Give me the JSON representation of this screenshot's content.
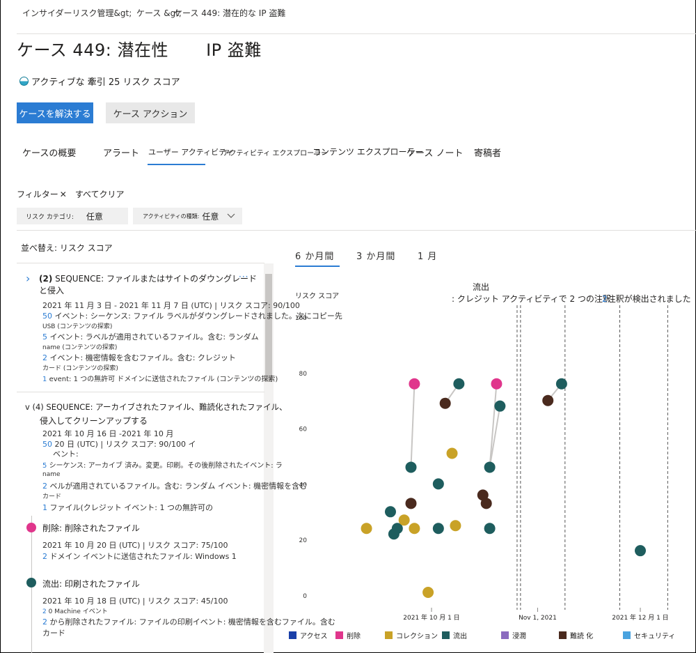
{
  "breadcrumb": {
    "item1": "インサイダーリスク管理&gt;",
    "item2": "ケース &gt;",
    "item3": "ケース 449: 潜在的な IP 盗難"
  },
  "header": {
    "title_part1": "ケース 449: 潜在性",
    "title_part2": "IP 盗難",
    "status_text": "アクティブな 牽引 25 リスク スコア"
  },
  "actions": {
    "resolve_label": "ケースを解決する",
    "case_actions_label": "ケース アクション"
  },
  "tabs": [
    {
      "label": "ケースの概要"
    },
    {
      "label": "アラート"
    },
    {
      "label": "ユーザー アクティビティ"
    },
    {
      "label": "アクティビティ エクスプローラー"
    },
    {
      "label": "コンテンツ エクスプローラー"
    },
    {
      "label": "ケース ノート"
    },
    {
      "label": "寄稿者"
    }
  ],
  "filters": {
    "filter_label": "フィルター",
    "clear_all": "すべてクリア",
    "risk_category_label": "リスク カテゴリ:",
    "risk_category_value": "任意",
    "activity_type_label": "アクティビティの種類:",
    "activity_type_value": "任意"
  },
  "list": {
    "sort_label": "並べ替え: リスク スコア",
    "seq1": {
      "title_count": "(2)",
      "title_rest": "SEQUENCE: ファイルまたはサイトのダウングレード",
      "title_line2": "と侵入",
      "date_line": "2021 年 11 月 3 日 - 2021 年 11 月 7 日 (UTC) | リスク スコア: 90/100",
      "l1_num": "50",
      "l1_text": "イベント: シーケンス: ファイル ラベルがダウングレードされました。次にコピー先",
      "l1b": "USB (コンテンツの探索)",
      "l2_num": "5",
      "l2_text": "イベント: ラベルが適用されているファイル。含む: ランダム",
      "l2b": "name (コンテンツの探索)",
      "l3_num": "2",
      "l3_text": "イベント: 機密情報を含むファイル。含む: クレジット",
      "l3b": "カード (コンテンツの探索)",
      "l4_num": "1",
      "l4_text": "event: 1 つの無許可 ドメインに送信されたファイル (コンテンツの探索)"
    },
    "seq2": {
      "title": "v (4) SEQUENCE: アーカイブされたファイル、難読化されたファイル、",
      "title_line2": "侵入してクリーンアップする",
      "date_line": "2021 年 10 月 16 日 -2021 年 10 月",
      "l1_num": "50",
      "l1_text": "20 日 (UTC) | リスク スコア: 90/100 イ",
      "l1b": "ベント:",
      "l2_num": "5",
      "l2_text": "シーケンス: アーカイブ 済み。変更。印刷。その後削除されたイベント: ラ",
      "l2b": "name",
      "l3_num": "2",
      "l3_text": "ベルが適用されているファイル。含む: ランダム イベント: 機密情報を含む",
      "l3b": "カード",
      "l4_num": "1",
      "l4_text": "ファイル(クレジット イベント: 1 つの無許可の"
    },
    "ev1": {
      "title": "削除: 削除されたファイル",
      "date_line": "2021 年 10 月 20 日 (UTC) | リスク スコア: 75/100",
      "l1_num": "2",
      "l1_text": "ドメイン イベントに送信されたファイル: Windows 1"
    },
    "ev2": {
      "title": "流出: 印刷されたファイル",
      "date_line": "2021 年 10 月 18 日 (UTC) | リスク スコア: 45/100",
      "l1_num": "2",
      "l1_text": "0 Machine イベント",
      "l2_num": "2",
      "l2_text": "から削除されたファイル: ファイルの印刷イベント: 機密情報を含むファイル。含む",
      "l2b": "カード"
    }
  },
  "chart_tabs": [
    {
      "label": "6 か月間"
    },
    {
      "label": "3 か月間"
    },
    {
      "label": "1 月"
    }
  ],
  "chart_annotations": {
    "a1_line1": "流出",
    "a1_line2": ": クレジット アクティビティで 2 つの注釈",
    "a2_num": "2",
    "a2_text": "注釈が検出されました"
  },
  "legend": [
    {
      "label": "アクセス",
      "color": "#1a3fa8"
    },
    {
      "label": "削除",
      "color": "#e0368c"
    },
    {
      "label": "コレクション",
      "color": "#c9a227"
    },
    {
      "label": "流出",
      "color": "#1e5d5e"
    },
    {
      "label": "浸潤",
      "color": "#8b6bbf"
    },
    {
      "label": "難読 化",
      "color": "#4a2a1e"
    },
    {
      "label": "セキュリティ",
      "color": "#4aa3df"
    }
  ],
  "chart_data": {
    "type": "scatter",
    "title": "",
    "ylabel": "リスク スコア",
    "ylim": [
      0,
      100
    ],
    "yticks": [
      "0",
      "20",
      "40",
      "60",
      "80",
      "100"
    ],
    "x_tick_labels": [
      "2021 年 10 月 1 日",
      "Nov 1, 2021",
      "2021 年 12 月 1 日"
    ],
    "grid": false,
    "legend_position": "bottom",
    "series": [
      {
        "name": "削除",
        "color": "#e0368c",
        "points": [
          [
            "2021-09-26",
            76
          ],
          [
            "2021-10-20",
            76
          ]
        ]
      },
      {
        "name": "流出",
        "color": "#1e5d5e",
        "points": [
          [
            "2021-09-19",
            30
          ],
          [
            "2021-09-20",
            22
          ],
          [
            "2021-09-21",
            24
          ],
          [
            "2021-09-25",
            46
          ],
          [
            "2021-10-03",
            40
          ],
          [
            "2021-10-03",
            24
          ],
          [
            "2021-10-09",
            76
          ],
          [
            "2021-10-18",
            46
          ],
          [
            "2021-10-18",
            24
          ],
          [
            "2021-10-21",
            68
          ],
          [
            "2021-11-08",
            76
          ],
          [
            "2021-12-01",
            16
          ]
        ]
      },
      {
        "name": "コレクション",
        "color": "#c9a227",
        "points": [
          [
            "2021-09-12",
            24
          ],
          [
            "2021-09-23",
            27
          ],
          [
            "2021-09-26",
            24
          ],
          [
            "2021-09-30",
            1
          ],
          [
            "2021-10-07",
            51
          ],
          [
            "2021-10-08",
            25
          ]
        ]
      },
      {
        "name": "難読 化",
        "color": "#4a2a1e",
        "points": [
          [
            "2021-09-25",
            33
          ],
          [
            "2021-10-05",
            69
          ],
          [
            "2021-10-16",
            36
          ],
          [
            "2021-10-17",
            33
          ],
          [
            "2021-11-04",
            70
          ]
        ]
      }
    ],
    "connections": [
      [
        [
          "2021-09-25",
          46
        ],
        [
          "2021-09-26",
          76
        ]
      ],
      [
        [
          "2021-10-05",
          69
        ],
        [
          "2021-10-09",
          76
        ]
      ],
      [
        [
          "2021-10-18",
          46
        ],
        [
          "2021-10-21",
          68
        ]
      ],
      [
        [
          "2021-10-18",
          46
        ],
        [
          "2021-10-20",
          76
        ]
      ],
      [
        [
          "2021-11-04",
          70
        ],
        [
          "2021-11-08",
          76
        ]
      ]
    ],
    "marker_lines": [
      "2021-10-26",
      "2021-10-27",
      "2021-11-09",
      "2021-11-25",
      "2021-12-09"
    ]
  }
}
